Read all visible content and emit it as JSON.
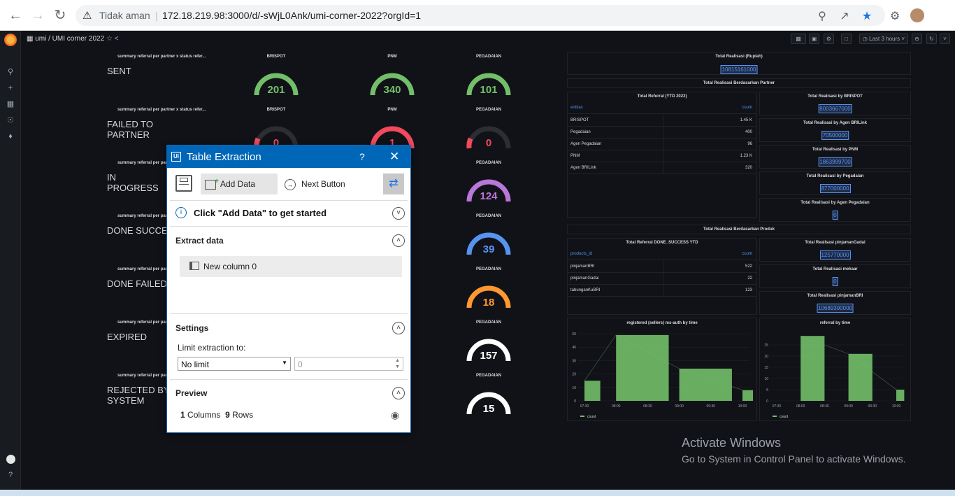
{
  "browser": {
    "not_secure": "Tidak aman",
    "separator": "|",
    "url": "172.18.219.98:3000/d/-sWjL0Ank/umi-corner-2022?orgId=1"
  },
  "grafana": {
    "breadcrumb": "umi / UMI corner 2022",
    "time_range": "Last 3 hours"
  },
  "rows": [
    {
      "title": "summary referral per partner x status refer...",
      "status": "SENT",
      "gauges": [
        {
          "label": "BRISPOT",
          "value": "201",
          "color": "#73bf69"
        },
        {
          "label": "PNM",
          "value": "340",
          "color": "#73bf69"
        },
        {
          "label": "PEGADAIAN",
          "value": "101",
          "color": "#73bf69"
        }
      ]
    },
    {
      "title": "summary referral per partner x status refer...",
      "status": "FAILED TO PARTNER",
      "gauges": [
        {
          "label": "BRISPOT",
          "value": "0",
          "color": "#f2495c"
        },
        {
          "label": "PNM",
          "value": "1",
          "color": "#f2495c"
        },
        {
          "label": "PEGADAIAN",
          "value": "0",
          "color": "#f2495c"
        }
      ]
    },
    {
      "title": "summary referral per partner x status refer...",
      "status": "IN PROGRESS",
      "gauges": [
        {
          "label": "PEGADAIAN",
          "value": "124",
          "color": "#b877d9"
        }
      ]
    },
    {
      "title": "summary referral per partner x status refer...",
      "status": "DONE SUCCE",
      "gauges": [
        {
          "label": "PEGADAIAN",
          "value": "39",
          "color": "#5794f2"
        }
      ]
    },
    {
      "title": "summary referral per partner x status refer...",
      "status": "DONE FAILED",
      "gauges": [
        {
          "label": "PEGADAIAN",
          "value": "18",
          "color": "#ff9830"
        }
      ]
    },
    {
      "title": "summary referral per partner x status refer...",
      "status": "EXPIRED",
      "gauges": [
        {
          "label": "PEGADAIAN",
          "value": "157",
          "color": "#ffffff"
        }
      ]
    },
    {
      "title": "summary referral per partner x status refer...",
      "status": "REJECTED BY SYSTEM",
      "gauges": [
        {
          "label": "PEGADAIAN",
          "value": "15",
          "color": "#ffffff"
        }
      ]
    }
  ],
  "total_realisasi": {
    "title": "Total Realisasi (Rupiah)",
    "value": "10815161000"
  },
  "section_partner": "Total Realisasi Berdasarkan Partner",
  "referral_table": {
    "title": "Total Referral (YTD 2022)",
    "headers": [
      "entitas",
      "count"
    ],
    "rows": [
      [
        "BRISPOT",
        "1.45 K"
      ],
      [
        "Pegadaian",
        "400"
      ],
      [
        "Agen Pegadaian",
        "96"
      ],
      [
        "PNM",
        "1.23 K"
      ],
      [
        "Agen BRILink",
        "320"
      ]
    ]
  },
  "partner_stats": [
    {
      "title": "Total Realisasi by BRISPOT",
      "value": "8003667000"
    },
    {
      "title": "Total Realisasi by Agen BRILink",
      "value": "70500000"
    },
    {
      "title": "Total Realisasi by PNM",
      "value": "1863999700"
    },
    {
      "title": "Total Realisasi by Pegadaian",
      "value": "877000000"
    },
    {
      "title": "Total Realisasi by Agen Pegadaian",
      "value": "0"
    }
  ],
  "section_produk": "Total Realisasi Berdasarkan Produk",
  "done_table": {
    "title": "Total Referral DONE_SUCCESS YTD",
    "headers": [
      "products_id",
      "count"
    ],
    "rows": [
      [
        "pinjamanBRI",
        "522"
      ],
      [
        "pinjamanGadai",
        "22"
      ],
      [
        "tabunganKuBRI",
        "123"
      ]
    ]
  },
  "produk_stats": [
    {
      "title": "Total Realisasi pinjamanGadai",
      "value": "125770000"
    },
    {
      "title": "Total Realisasi mekaar",
      "value": "0"
    },
    {
      "title": "Total Realisasi pinjamanBRI",
      "value": "10689390000"
    }
  ],
  "chart_data": [
    {
      "type": "bar",
      "title": "registered (sellers) ms-auth by time",
      "categories": [
        "07:30",
        "08:00",
        "08:30",
        "09:00",
        "09:30",
        "10:00"
      ],
      "series": [
        {
          "name": "count",
          "values": [
            15,
            49,
            49,
            24,
            24,
            8
          ]
        }
      ],
      "bars": [
        {
          "start": "07:30",
          "end": "07:45",
          "value": 15
        },
        {
          "start": "08:00",
          "end": "08:50",
          "value": 49
        },
        {
          "start": "09:00",
          "end": "09:50",
          "value": 24
        },
        {
          "start": "10:00",
          "end": "10:10",
          "value": 8
        }
      ],
      "yticks": [
        0,
        10,
        20,
        30,
        40,
        50
      ],
      "ylim": [
        0,
        50
      ],
      "legend": "bottom-left"
    },
    {
      "type": "bar",
      "title": "referral by time",
      "categories": [
        "07:30",
        "08:00",
        "08:30",
        "09:00",
        "09:30",
        "10:00"
      ],
      "series": [
        {
          "name": "count",
          "values": [
            0,
            29,
            29,
            21,
            21,
            5
          ]
        }
      ],
      "bars": [
        {
          "start": "08:00",
          "end": "08:30",
          "value": 29
        },
        {
          "start": "09:00",
          "end": "09:30",
          "value": 21
        },
        {
          "start": "10:00",
          "end": "10:10",
          "value": 5
        }
      ],
      "yticks": [
        0,
        5,
        10,
        15,
        20,
        25
      ],
      "ylim": [
        0,
        30
      ],
      "legend": "bottom-left"
    }
  ],
  "dialog": {
    "title": "Table Extraction",
    "help": "?",
    "add_data": "Add Data",
    "next_button": "Next Button",
    "hint": "Click \"Add Data\" to get started",
    "extract_data": "Extract data",
    "new_column": "New column 0",
    "settings": "Settings",
    "limit_label": "Limit extraction to:",
    "limit_value": "No limit",
    "limit_number": "0",
    "preview": "Preview",
    "columns_count": "1",
    "columns_label": "Columns",
    "rows_count": "9",
    "rows_label": "Rows"
  },
  "windows": {
    "activate_title": "Activate Windows",
    "activate_sub": "Go to System in Control Panel to activate Windows."
  }
}
